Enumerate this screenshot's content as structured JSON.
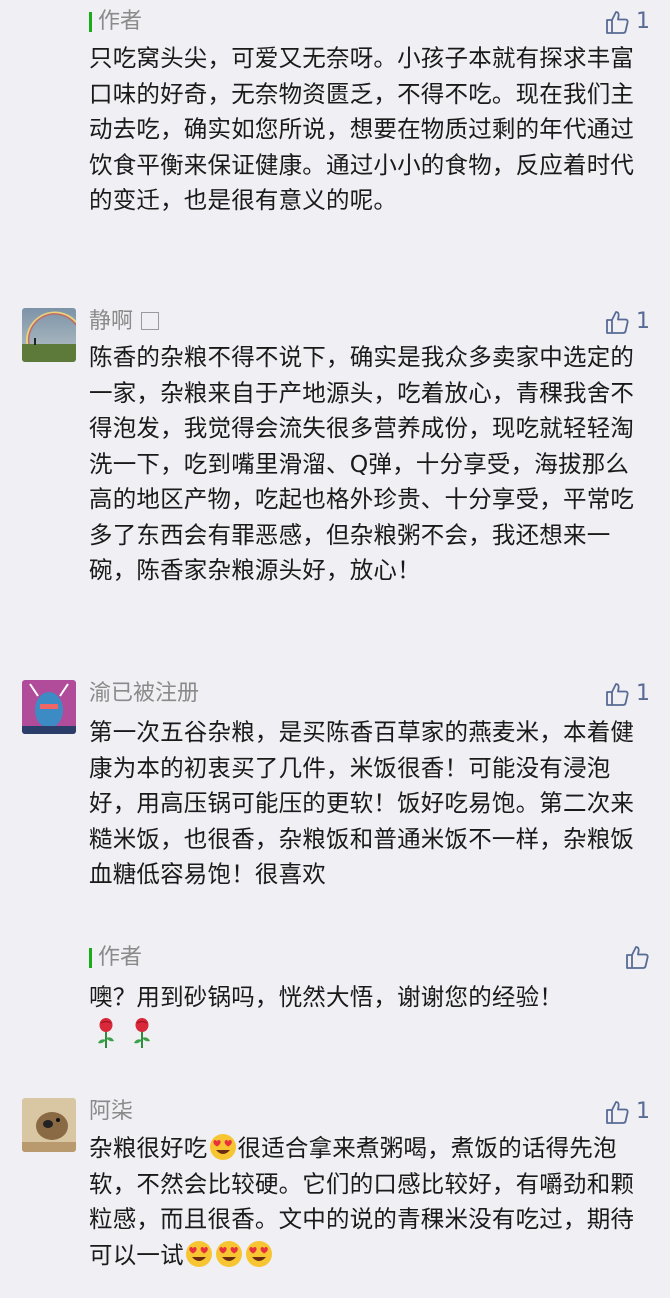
{
  "comments": [
    {
      "reply_label": "作者",
      "likes": "1",
      "text": "只吃窝头尖，可爱又无奈呀。小孩子本就有探求丰富口味的好奇，无奈物资匮乏，不得不吃。现在我们主动去吃，确实如您所说，想要在物质过剩的年代通过饮食平衡来保证健康。通过小小的食物，反应着时代的变迁，也是很有意义的呢。"
    },
    {
      "user": "静啊",
      "likes": "1",
      "text": "陈香的杂粮不得不说下，确实是我众多卖家中选定的一家，杂粮来自于产地源头，吃着放心，青稞我舍不得泡发，我觉得会流失很多营养成份，现吃就轻轻淘洗一下，吃到嘴里滑溜、Q弹，十分享受，海拔那么高的地区产物，吃起也格外珍贵、十分享受，平常吃多了东西会有罪恶感，但杂粮粥不会，我还想来一碗，陈香家杂粮源头好，放心！"
    },
    {
      "user": "渝已被注册",
      "likes": "1",
      "text": "第一次五谷杂粮，是买陈香百草家的燕麦米，本着健康为本的初衷买了几件，米饭很香！可能没有浸泡好，用高压锅可能压的更软！饭好吃易饱。第二次来糙米饭，也很香，杂粮饭和普通米饭不一样，杂粮饭血糖低容易饱！很喜欢",
      "reply_label": "作者",
      "reply_text": "噢？用到砂锅吗，恍然大悟，谢谢您的经验！"
    },
    {
      "user": "阿柒",
      "likes": "1",
      "text_a": "杂粮很好吃",
      "text_b": "很适合拿来煮粥喝，煮饭的话得先泡软，不然会比较硬。它们的口感比较好，有嚼劲和颗粒感，而且很香。文中的说的青稞米没有吃过，期待可以一试"
    }
  ],
  "icons": {
    "like": "thumbs-up-icon",
    "verify": "checkbox-icon",
    "emoji": "heart-eyes-emoji",
    "rose": "rose-emoji"
  },
  "colors": {
    "background": "#efeff4",
    "link_blue": "#576b95",
    "author_green": "#1aad19",
    "meta_gray": "#8a8a8a"
  }
}
